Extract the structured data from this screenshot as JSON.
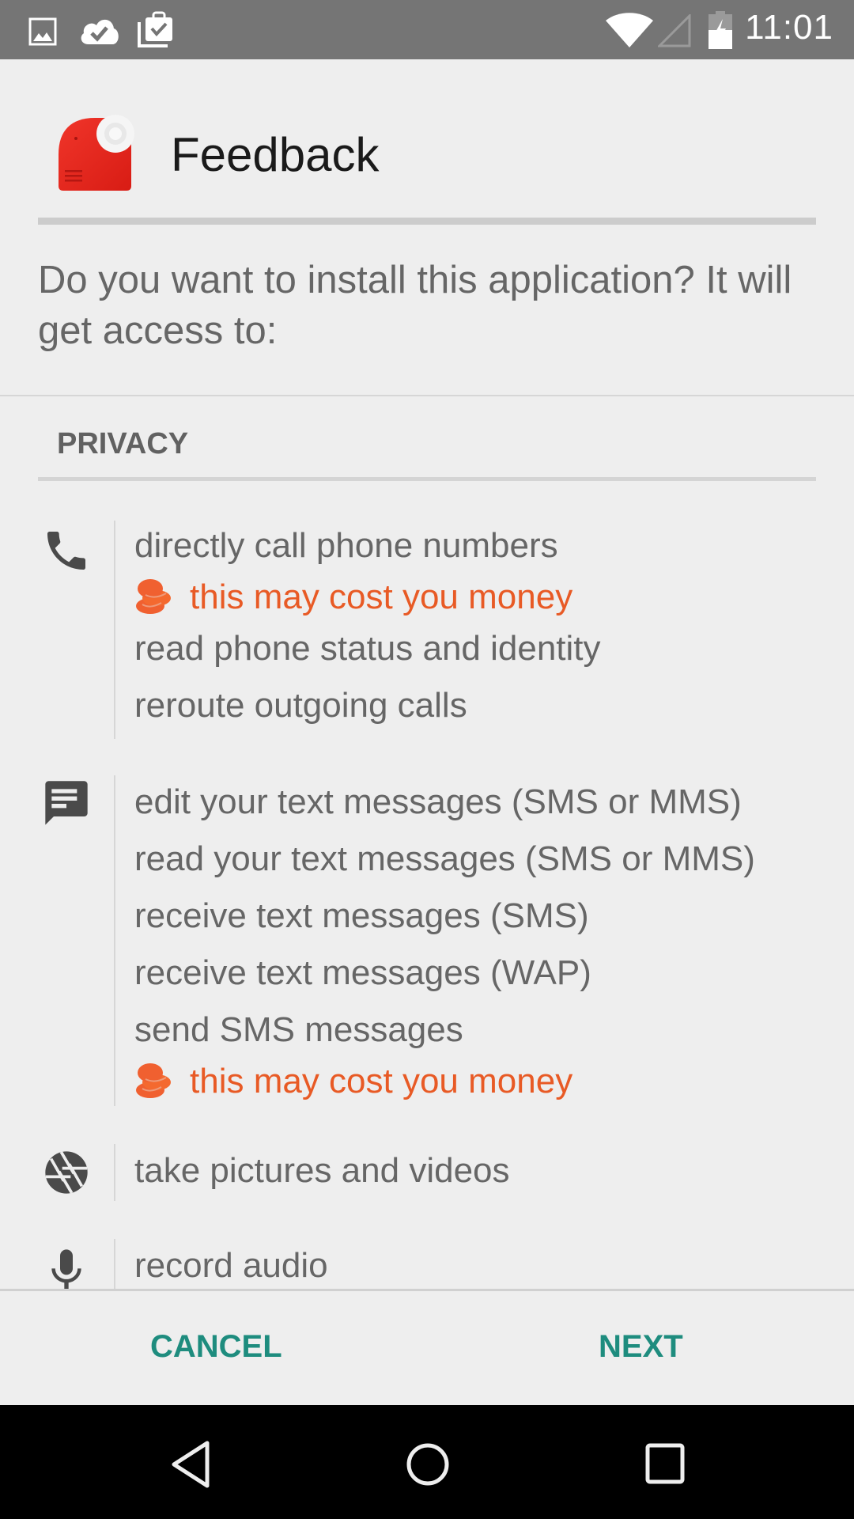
{
  "status_bar": {
    "time": "11:01",
    "left_icons": [
      "image-icon",
      "cloud-done-icon",
      "clipboard-check-icon"
    ],
    "right_icons": [
      "wifi-icon",
      "cell-signal-icon",
      "battery-charging-icon"
    ]
  },
  "header": {
    "app_name": "Feedback",
    "app_icon": "feedback-app-icon"
  },
  "question": "Do you want to install this application? It will get access to:",
  "section": {
    "title": "PRIVACY"
  },
  "permission_groups": [
    {
      "icon": "phone-icon",
      "lines": [
        {
          "text": "directly call phone numbers",
          "type": "normal"
        },
        {
          "text": "this may cost you money",
          "type": "cost"
        },
        {
          "text": "read phone status and identity",
          "type": "normal"
        },
        {
          "text": "reroute outgoing calls",
          "type": "normal"
        }
      ]
    },
    {
      "icon": "message-icon",
      "lines": [
        {
          "text": "edit your text messages (SMS or MMS)",
          "type": "normal"
        },
        {
          "text": "read your text messages (SMS or MMS)",
          "type": "normal"
        },
        {
          "text": "receive text messages (SMS)",
          "type": "normal"
        },
        {
          "text": "receive text messages (WAP)",
          "type": "normal"
        },
        {
          "text": "send SMS messages",
          "type": "normal"
        },
        {
          "text": "this may cost you money",
          "type": "cost"
        }
      ]
    },
    {
      "icon": "camera-aperture-icon",
      "lines": [
        {
          "text": "take pictures and videos",
          "type": "normal"
        }
      ]
    },
    {
      "icon": "microphone-icon",
      "lines": [
        {
          "text": "record audio",
          "type": "normal"
        }
      ]
    }
  ],
  "buttons": {
    "cancel": "CANCEL",
    "next": "NEXT"
  },
  "colors": {
    "accent": "#1e8c7e",
    "cost_warning": "#e85a25",
    "status_bar": "#757575",
    "background": "#eeeeee"
  },
  "nav_bar": {
    "buttons": [
      "back-icon",
      "home-icon",
      "recents-icon"
    ]
  }
}
